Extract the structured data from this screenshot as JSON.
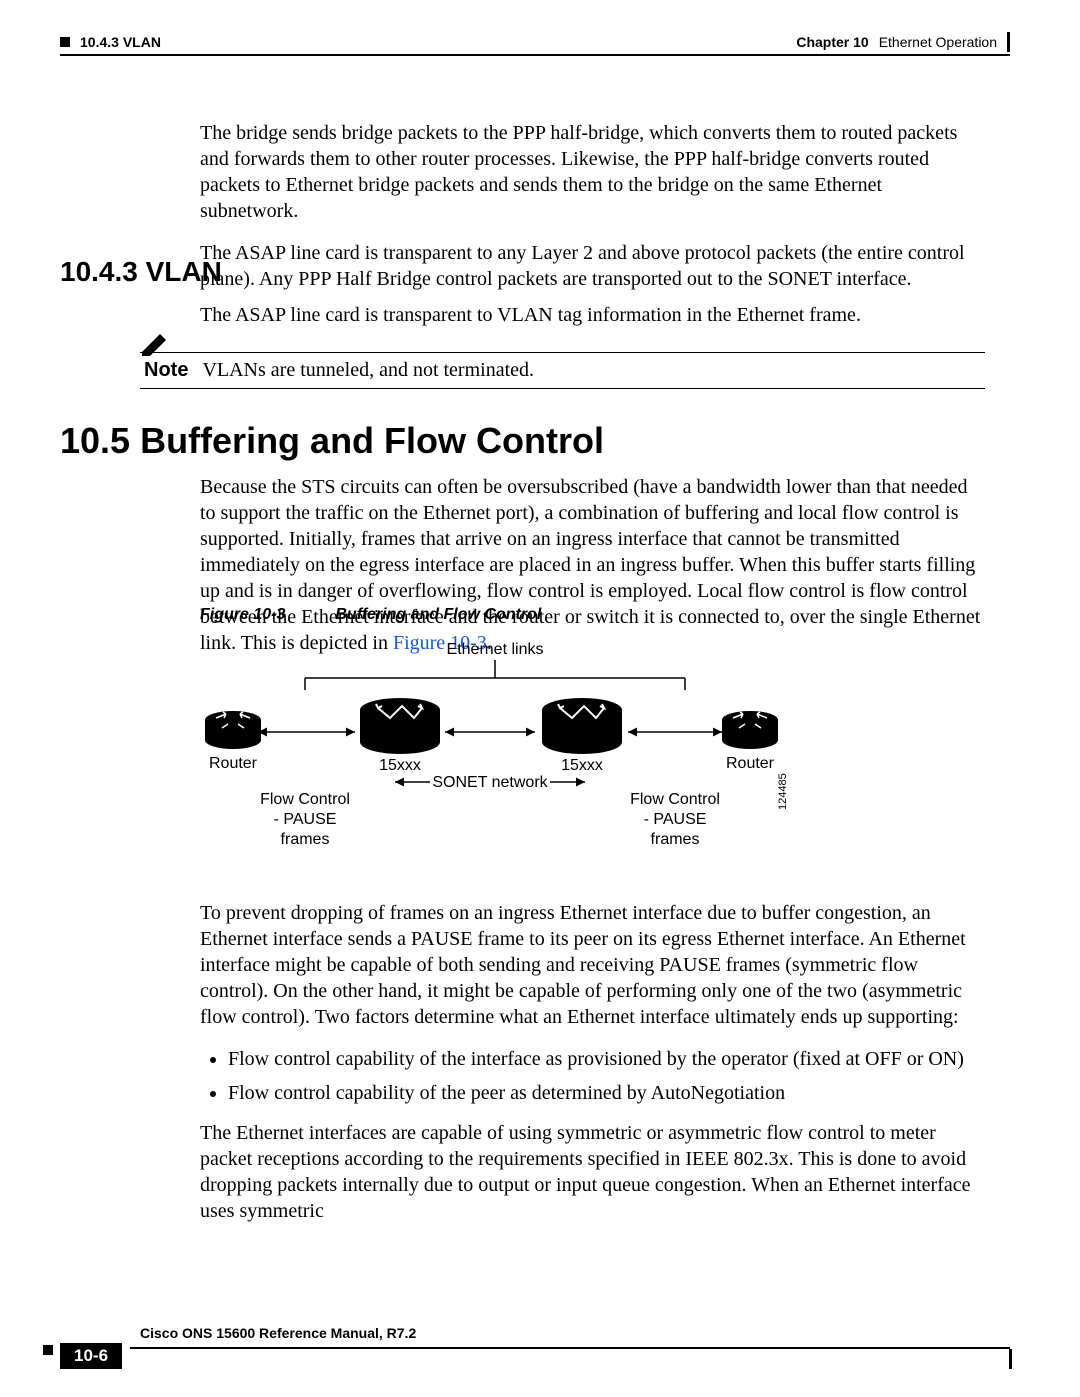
{
  "header": {
    "left_section": "10.4.3  VLAN",
    "right_chapter": "Chapter 10",
    "right_title": "Ethernet Operation"
  },
  "intro": {
    "p1": "The bridge sends bridge packets to the PPP half-bridge, which converts them to routed packets and forwards them to other router processes. Likewise, the PPP half-bridge converts routed packets to Ethernet bridge packets and sends them to the bridge on the same Ethernet subnetwork.",
    "p2": "The ASAP line card is transparent to any Layer 2 and above protocol packets (the entire control plane). Any PPP Half Bridge control packets are transported out to the SONET interface."
  },
  "vlan": {
    "heading": "10.4.3  VLAN",
    "p1": "The ASAP line card is transparent to VLAN tag information in the Ethernet frame.",
    "note_label": "Note",
    "note_text": "VLANs are tunneled, and not terminated."
  },
  "buffering": {
    "heading": "10.5  Buffering and Flow Control",
    "p1a": "Because the STS circuits can often be oversubscribed (have a bandwidth lower than that needed to support the traffic on the Ethernet port), a combination of buffering and local flow control is supported. Initially, frames that arrive on an ingress interface that cannot be transmitted immediately on the egress interface are placed in an ingress buffer. When this buffer starts filling up and is in danger of overflowing, flow control is employed. Local flow control is flow control between the Ethernet interface and the router or switch it is connected to, over the single Ethernet link. This is depicted in ",
    "fig_link": "Figure 10-3",
    "p1b": "."
  },
  "figure": {
    "caption_num": "Figure 10-3",
    "caption_title": "Buffering and Flow Control",
    "labels": {
      "ethernet_links": "Ethernet links",
      "router_left": "Router",
      "router_right": "Router",
      "node_left": "15xxx",
      "node_right": "15xxx",
      "sonet": "SONET network",
      "flow_left_1": "Flow Control",
      "flow_left_2": "- PAUSE",
      "flow_left_3": "frames",
      "flow_right_1": "Flow Control",
      "flow_right_2": "- PAUSE",
      "flow_right_3": "frames",
      "id": "124485"
    }
  },
  "post": {
    "p1": "To prevent dropping of frames on an ingress Ethernet interface due to buffer congestion, an Ethernet interface sends a PAUSE frame to its peer on its egress Ethernet interface. An Ethernet interface might be capable of both sending and receiving PAUSE frames (symmetric flow control). On the other hand, it might be capable of performing only one of the two (asymmetric flow control). Two factors determine what an Ethernet interface ultimately ends up supporting:",
    "b1": "Flow control capability of the interface as provisioned by the operator (fixed at OFF or ON)",
    "b2": "Flow control capability of the peer as determined by AutoNegotiation",
    "p2": "The Ethernet interfaces are capable of using symmetric or asymmetric flow control to meter packet receptions according to the requirements specified in IEEE 802.3x. This is done to avoid dropping packets internally due to output or input queue congestion. When an Ethernet interface uses symmetric"
  },
  "footer": {
    "manual": "Cisco ONS 15600 Reference Manual, R7.2",
    "page": "10-6"
  }
}
